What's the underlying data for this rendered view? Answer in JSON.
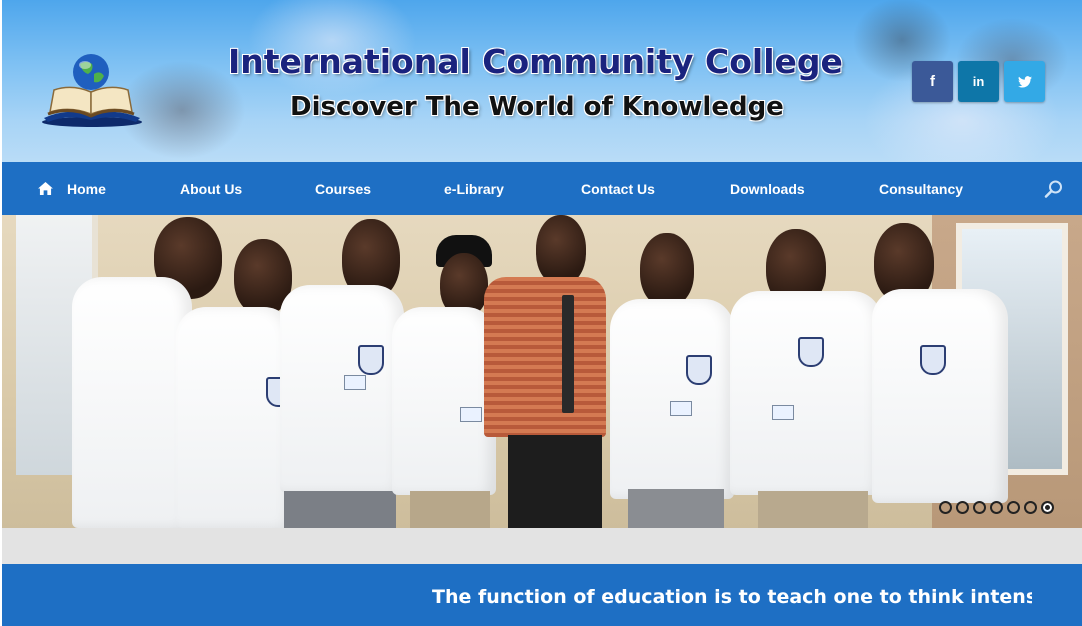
{
  "header": {
    "title": "International Community College",
    "tagline": "Discover The World of Knowledge",
    "social": [
      {
        "name": "facebook",
        "label": "f",
        "color": "#3b5998"
      },
      {
        "name": "linkedin",
        "label": "in",
        "color": "#0e76a8"
      },
      {
        "name": "twitter",
        "label": "🐦",
        "color": "#33a9e6"
      }
    ]
  },
  "nav": {
    "items": [
      {
        "label": "Home",
        "icon": "home-icon"
      },
      {
        "label": "About Us"
      },
      {
        "label": "Courses"
      },
      {
        "label": "e-Library"
      },
      {
        "label": "Contact Us"
      },
      {
        "label": "Downloads"
      },
      {
        "label": "Consultancy"
      }
    ],
    "search_icon": "search-icon",
    "background": "#1e6fc4"
  },
  "slider": {
    "slide_count": 7,
    "active_slide": 7
  },
  "quote": {
    "text": "The function of education is to teach one to think intensively and"
  },
  "colors": {
    "nav_blue": "#1e6fc4",
    "header_title": "#1a237e",
    "gap_gray": "#e3e3e3"
  }
}
